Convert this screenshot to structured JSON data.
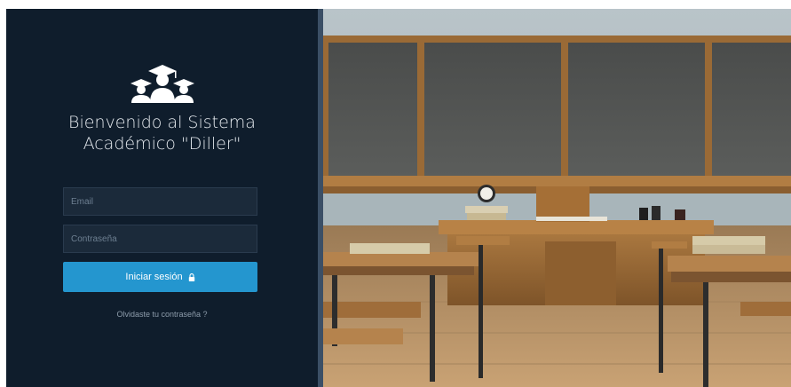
{
  "login": {
    "title_line1": "Bienvenido al Sistema",
    "title_line2": "Académico \"Diller\"",
    "email_placeholder": "Email",
    "password_placeholder": "Contraseña",
    "submit_label": "Iniciar sesión",
    "forgot_label": "Olvidaste tu contraseña ?"
  },
  "colors": {
    "panel_bg": "#0f1d2c",
    "button_bg": "#2496cf",
    "input_bg": "#1b2a3a"
  },
  "icons": {
    "logo": "graduates-group-icon",
    "submit": "lock-icon"
  }
}
